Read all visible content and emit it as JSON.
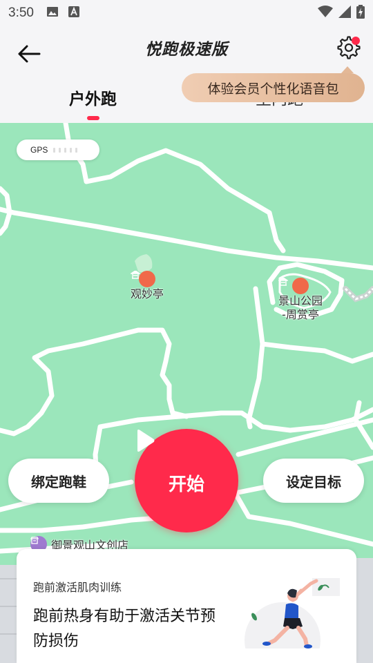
{
  "status_bar": {
    "time": "3:50",
    "left_icons": [
      "image-icon",
      "font-a-icon"
    ],
    "right_icons": [
      "wifi-icon",
      "signal-icon",
      "battery-charging-icon"
    ]
  },
  "header": {
    "title": "悦跑极速版",
    "back_icon": "arrow-left-icon",
    "settings_icon": "gear-icon",
    "settings_badge_color": "#ff2a4b"
  },
  "tabs": {
    "outdoor": "户外跑",
    "indoor": "室内跑",
    "active": "outdoor",
    "indicator_color": "#ff2a4b"
  },
  "tooltip": {
    "text": "体验会员个性化语音包"
  },
  "map": {
    "gps_label": "GPS",
    "gps_signal_bars": 5,
    "pois": [
      {
        "name": "观妙亭",
        "icon": "pavilion-icon"
      },
      {
        "name": "景山公园\n-周赏亭",
        "icon": "pavilion-icon"
      }
    ],
    "shop": {
      "name": "御景观山文创店",
      "icon": "shop-icon"
    }
  },
  "actions": {
    "bind_shoes": "绑定跑鞋",
    "start": "开始",
    "start_icon": "play-icon",
    "set_goal": "设定目标",
    "accent_color": "#ff2a4b"
  },
  "card": {
    "subtitle": "跑前激活肌肉训练",
    "title": "跑前热身有助于激活关节预防损伤",
    "illustration": "stretching-woman-illustration"
  }
}
